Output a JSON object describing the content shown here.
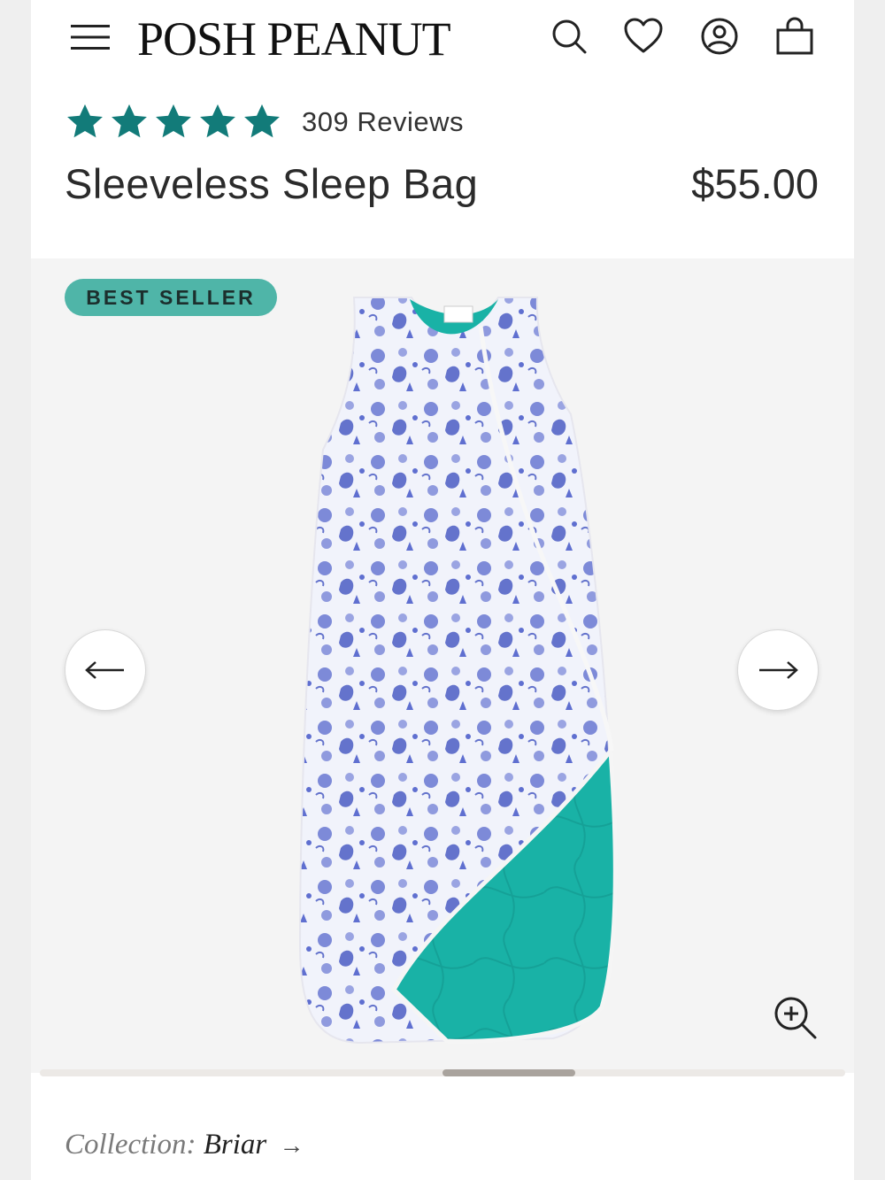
{
  "header": {
    "logo": "POSH PEANUT",
    "icons": [
      "menu-icon",
      "search-icon",
      "heart-icon",
      "account-icon",
      "bag-icon"
    ]
  },
  "product": {
    "rating": 5,
    "rating_max": 5,
    "reviews_label": "309 Reviews",
    "title": "Sleeveless Sleep Bag",
    "price": "$55.00"
  },
  "gallery": {
    "badge": "BEST SELLER",
    "prev_icon": "arrow-left-icon",
    "next_icon": "arrow-right-icon",
    "zoom_icon": "zoom-in-icon"
  },
  "collection": {
    "label": "Collection:",
    "value": "Briar",
    "arrow": "→"
  },
  "colors": {
    "star": "#127b79",
    "badge": "#4fb5a8",
    "fabric_print": "#5f6fd0",
    "fabric_lining": "#19b2a6"
  }
}
